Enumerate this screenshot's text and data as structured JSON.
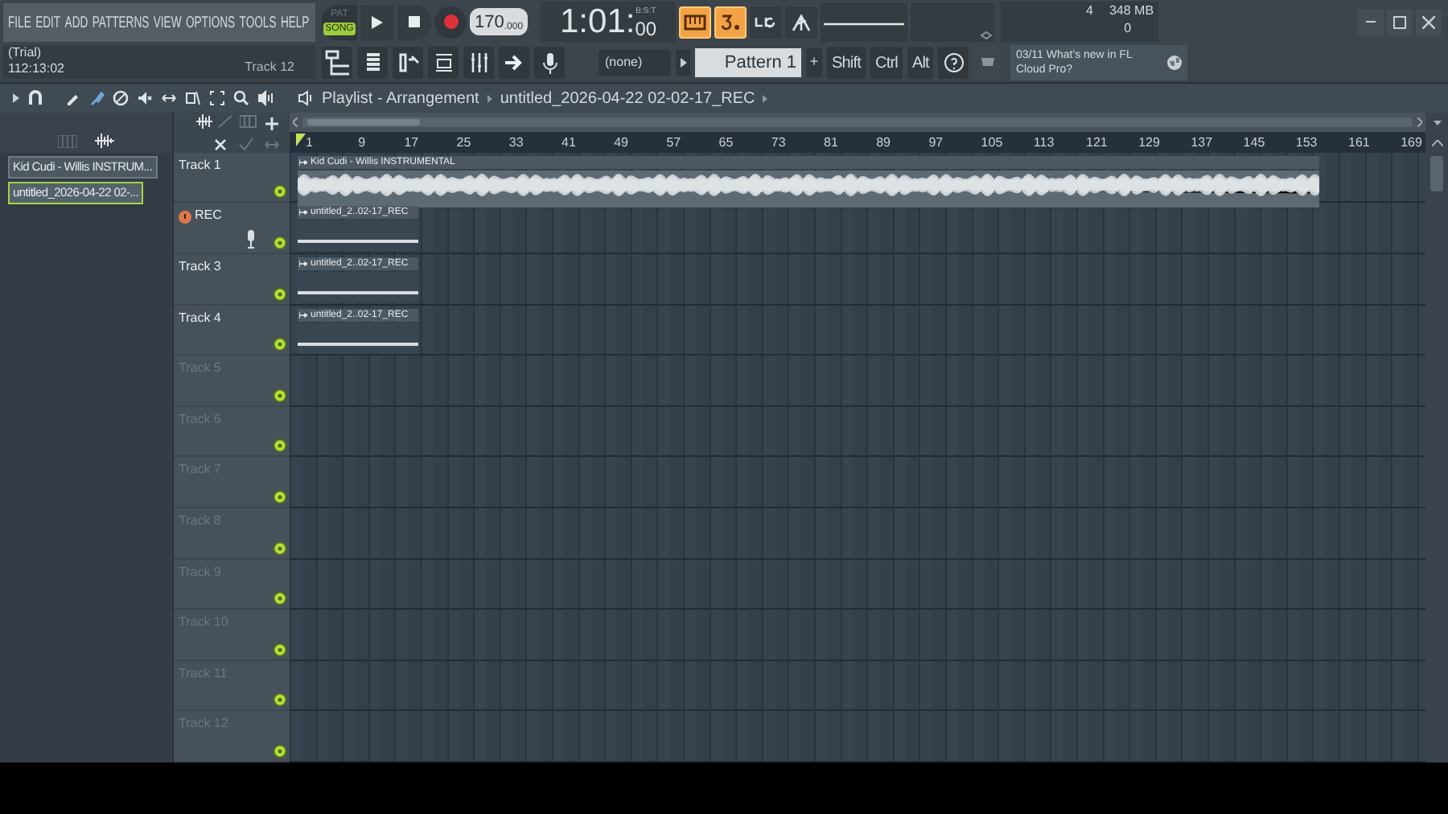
{
  "menu": [
    "FILE",
    "EDIT",
    "ADD",
    "PATTERNS",
    "VIEW",
    "OPTIONS",
    "TOOLS",
    "HELP"
  ],
  "info": {
    "title": "(Trial)",
    "time": "112:13:02",
    "hint": "Track 12"
  },
  "transport": {
    "modes": [
      {
        "label": "PAT",
        "selected": false
      },
      {
        "label": "SONG",
        "selected": true
      }
    ],
    "recording": false,
    "tempo": "170",
    "tempo_fraction": ".000",
    "time": "1:01:",
    "ticks": "00",
    "time_format": "B:S:T"
  },
  "toggles": [
    {
      "on": true
    },
    {
      "on": true
    },
    {
      "on": false
    },
    {
      "on": false
    }
  ],
  "monitor": {
    "cpu": "4",
    "memory": "348 MB",
    "polyphony": "0"
  },
  "pattern_selector": {
    "value": "(none)"
  },
  "pattern": "Pattern 1",
  "add_pattern": "+",
  "modifiers": [
    "Shift",
    "Ctrl",
    "Alt"
  ],
  "news": {
    "date": "03/11",
    "text": "What's new in FL Cloud Pro?"
  },
  "playlist": {
    "title": "Playlist - Arrangement",
    "breadcrumb": "untitled_2026-04-22 02-02-17_REC"
  },
  "clip_list": [
    {
      "label": "Kid Cudi - Willis INSTRUM...",
      "selected": false
    },
    {
      "label": "untitled_2026-04-22 02-...",
      "selected": true
    }
  ],
  "ruler": [
    "1",
    "9",
    "17",
    "25",
    "33",
    "41",
    "49",
    "57",
    "65",
    "73",
    "81",
    "89",
    "97",
    "105",
    "113",
    "121",
    "129",
    "137",
    "145",
    "153",
    "161",
    "169"
  ],
  "tracks": [
    {
      "name": "Track 1",
      "empty": false,
      "recording": false,
      "clips": [
        {
          "kind": "waveform",
          "label": "Kid Cudi - Willis INSTRUMENTAL"
        }
      ]
    },
    {
      "name": "REC",
      "empty": false,
      "recording": true,
      "clips": [
        {
          "kind": "take",
          "label": "untitled_2..02-17_REC"
        }
      ]
    },
    {
      "name": "Track 3",
      "empty": false,
      "recording": false,
      "clips": [
        {
          "kind": "take",
          "label": "untitled_2..02-17_REC"
        }
      ]
    },
    {
      "name": "Track 4",
      "empty": false,
      "recording": false,
      "clips": [
        {
          "kind": "take",
          "label": "untitled_2..02-17_REC"
        }
      ]
    },
    {
      "name": "Track 5",
      "empty": true,
      "recording": false
    },
    {
      "name": "Track 6",
      "empty": true,
      "recording": false
    },
    {
      "name": "Track 7",
      "empty": true,
      "recording": false
    },
    {
      "name": "Track 8",
      "empty": true,
      "recording": false
    },
    {
      "name": "Track 9",
      "empty": true,
      "recording": false
    },
    {
      "name": "Track 10",
      "empty": true,
      "recording": false
    },
    {
      "name": "Track 11",
      "empty": true,
      "recording": false
    },
    {
      "name": "Track 12",
      "empty": true,
      "recording": false
    }
  ]
}
